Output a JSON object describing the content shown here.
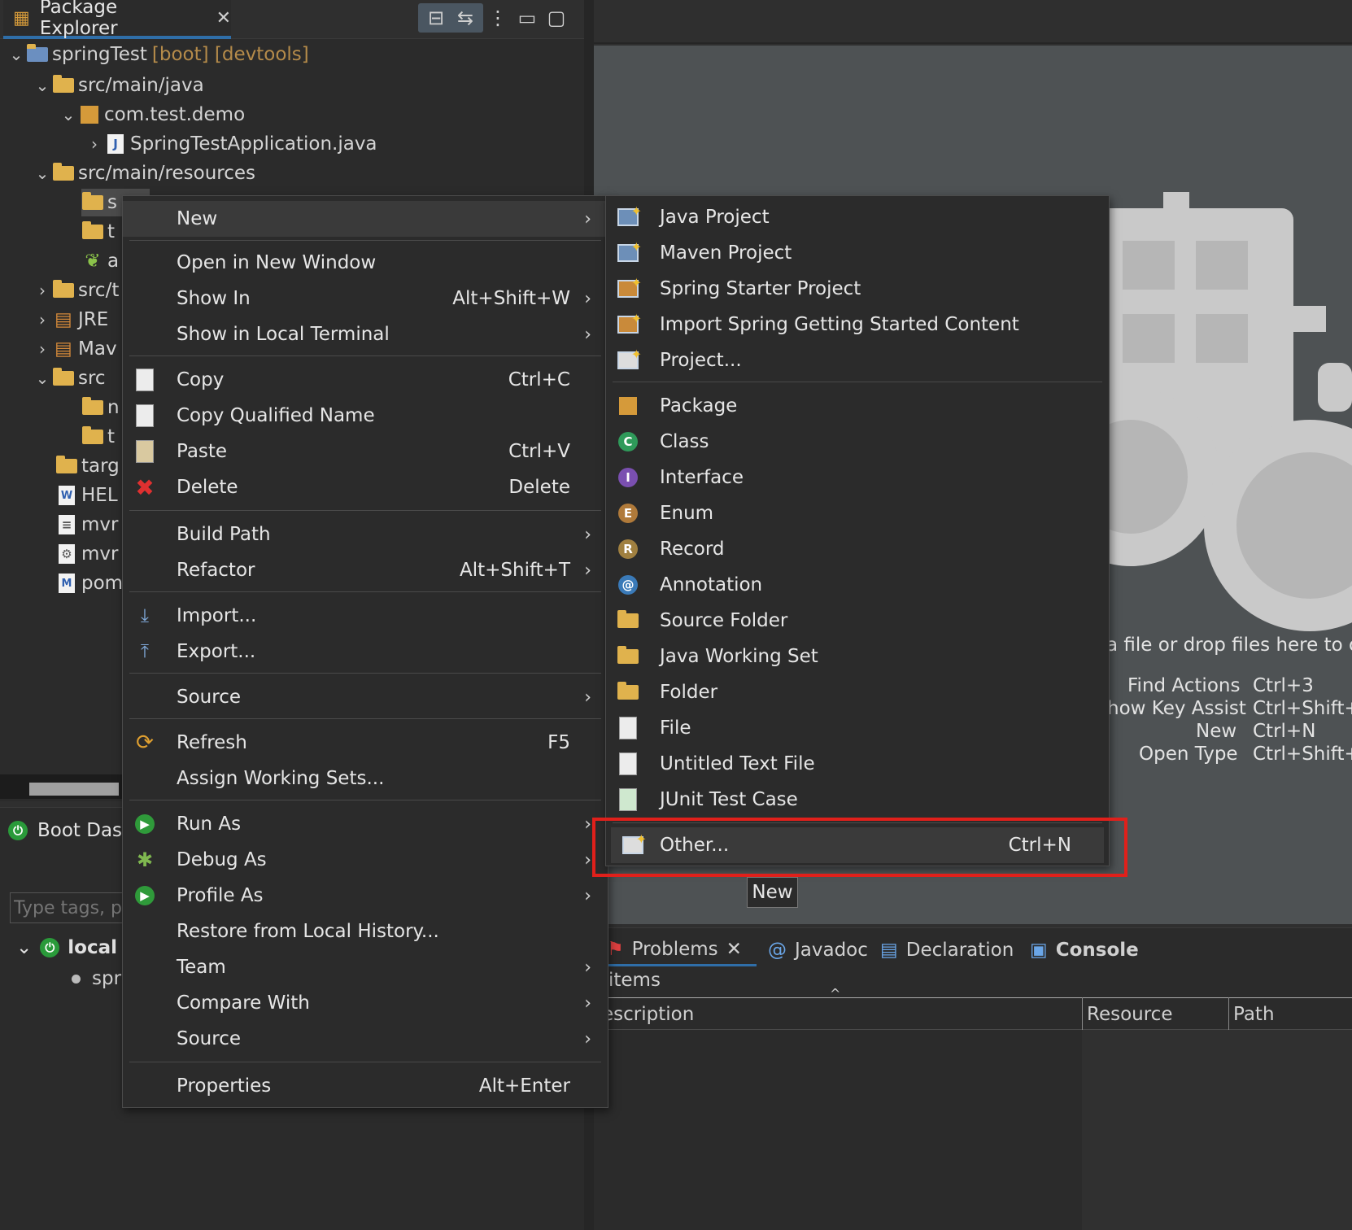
{
  "explorer": {
    "title": "Package Explorer",
    "tree": [
      {
        "label": "springTest",
        "decor": "[boot] [devtools]"
      },
      {
        "label": "src/main/java"
      },
      {
        "label": "com.test.demo"
      },
      {
        "label": "SpringTestApplication.java"
      },
      {
        "label": "src/main/resources"
      },
      {
        "label": "s"
      },
      {
        "label": "t"
      },
      {
        "label": "a"
      },
      {
        "label": "src/t"
      },
      {
        "label": "JRE"
      },
      {
        "label": "Mav"
      },
      {
        "label": "src"
      },
      {
        "label": "n"
      },
      {
        "label": "t"
      },
      {
        "label": "targ"
      },
      {
        "label": "HEL"
      },
      {
        "label": "mvr"
      },
      {
        "label": "mvr"
      },
      {
        "label": "pom"
      }
    ]
  },
  "boot": {
    "title": "Boot Das",
    "filter_placeholder": "Type tags, pr",
    "local_label": "local",
    "app_label": "spr"
  },
  "menu1": {
    "items": [
      {
        "label": "New",
        "key": "",
        "arrow": "›"
      },
      {
        "label": "Open in New Window",
        "key": "",
        "arrow": ""
      },
      {
        "label": "Show In",
        "key": "Alt+Shift+W",
        "arrow": "›"
      },
      {
        "label": "Show in Local Terminal",
        "key": "",
        "arrow": "›"
      },
      {
        "label": "Copy",
        "key": "Ctrl+C",
        "arrow": ""
      },
      {
        "label": "Copy Qualified Name",
        "key": "",
        "arrow": ""
      },
      {
        "label": "Paste",
        "key": "Ctrl+V",
        "arrow": ""
      },
      {
        "label": "Delete",
        "key": "Delete",
        "arrow": ""
      },
      {
        "label": "Build Path",
        "key": "",
        "arrow": "›"
      },
      {
        "label": "Refactor",
        "key": "Alt+Shift+T",
        "arrow": "›"
      },
      {
        "label": "Import...",
        "key": "",
        "arrow": ""
      },
      {
        "label": "Export...",
        "key": "",
        "arrow": ""
      },
      {
        "label": "Source",
        "key": "",
        "arrow": "›"
      },
      {
        "label": "Refresh",
        "key": "F5",
        "arrow": ""
      },
      {
        "label": "Assign Working Sets...",
        "key": "",
        "arrow": ""
      },
      {
        "label": "Run As",
        "key": "",
        "arrow": "›"
      },
      {
        "label": "Debug As",
        "key": "",
        "arrow": "›"
      },
      {
        "label": "Profile As",
        "key": "",
        "arrow": "›"
      },
      {
        "label": "Restore from Local History...",
        "key": "",
        "arrow": ""
      },
      {
        "label": "Team",
        "key": "",
        "arrow": "›"
      },
      {
        "label": "Compare With",
        "key": "",
        "arrow": "›"
      },
      {
        "label": "Source",
        "key": "",
        "arrow": "›"
      },
      {
        "label": "Properties",
        "key": "Alt+Enter",
        "arrow": ""
      }
    ]
  },
  "menu2": {
    "items": [
      {
        "label": "Java Project"
      },
      {
        "label": "Maven Project"
      },
      {
        "label": "Spring Starter Project"
      },
      {
        "label": "Import Spring Getting Started Content"
      },
      {
        "label": "Project..."
      },
      {
        "label": "Package"
      },
      {
        "label": "Class"
      },
      {
        "label": "Interface"
      },
      {
        "label": "Enum"
      },
      {
        "label": "Record"
      },
      {
        "label": "Annotation"
      },
      {
        "label": "Source Folder"
      },
      {
        "label": "Java Working Set"
      },
      {
        "label": "Folder"
      },
      {
        "label": "File"
      },
      {
        "label": "Untitled Text File"
      },
      {
        "label": "JUnit Test Case"
      },
      {
        "label": "Other...",
        "key": "Ctrl+N"
      }
    ]
  },
  "tooltip": "New",
  "editor": {
    "hint": "a file or drop files here to op",
    "shortcuts": [
      {
        "action": "Find Actions",
        "key": "Ctrl+3"
      },
      {
        "action": "how Key Assist",
        "key": "Ctrl+Shift+L"
      },
      {
        "action": "New",
        "key": "Ctrl+N"
      },
      {
        "action": "Open Type",
        "key": "Ctrl+Shift+T"
      }
    ]
  },
  "bottom": {
    "tabs": [
      "Problems",
      "Javadoc",
      "Declaration",
      "Console"
    ],
    "items_label": "items",
    "columns": [
      "escription",
      "Resource",
      "Path"
    ]
  },
  "colors": {
    "accent": "#2f6ea8",
    "highlight_box": "#e0201b"
  }
}
